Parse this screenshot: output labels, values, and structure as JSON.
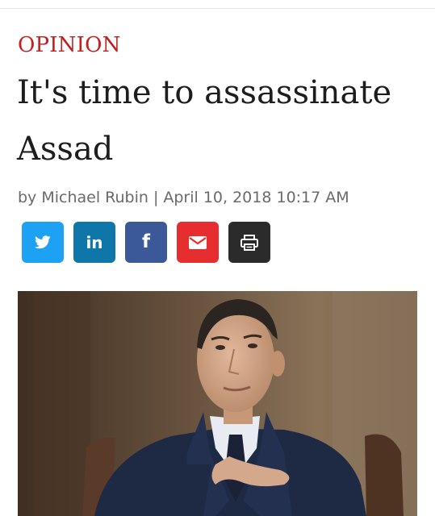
{
  "article": {
    "section": "OPINION",
    "headline": "It's time to assassinate Assad",
    "byline": {
      "prefix": "by",
      "author": "Michael Rubin",
      "separator": "|",
      "date": "April 10, 2018 10:17 AM"
    }
  },
  "share": [
    {
      "name": "twitter",
      "icon": "twitter-bird-icon",
      "color": "#1da1f2"
    },
    {
      "name": "linkedin",
      "icon": "linkedin-in-icon",
      "text": "in",
      "color": "#0e76a8"
    },
    {
      "name": "facebook",
      "icon": "facebook-f-icon",
      "text": "f",
      "color": "#3b5998"
    },
    {
      "name": "email",
      "icon": "envelope-icon",
      "color": "#e62e2e"
    },
    {
      "name": "print",
      "icon": "printer-icon",
      "color": "#2b2b2b"
    }
  ],
  "colors": {
    "section": "#c0211f",
    "headline": "#1d1d1d",
    "byline": "#6a6a6a"
  }
}
